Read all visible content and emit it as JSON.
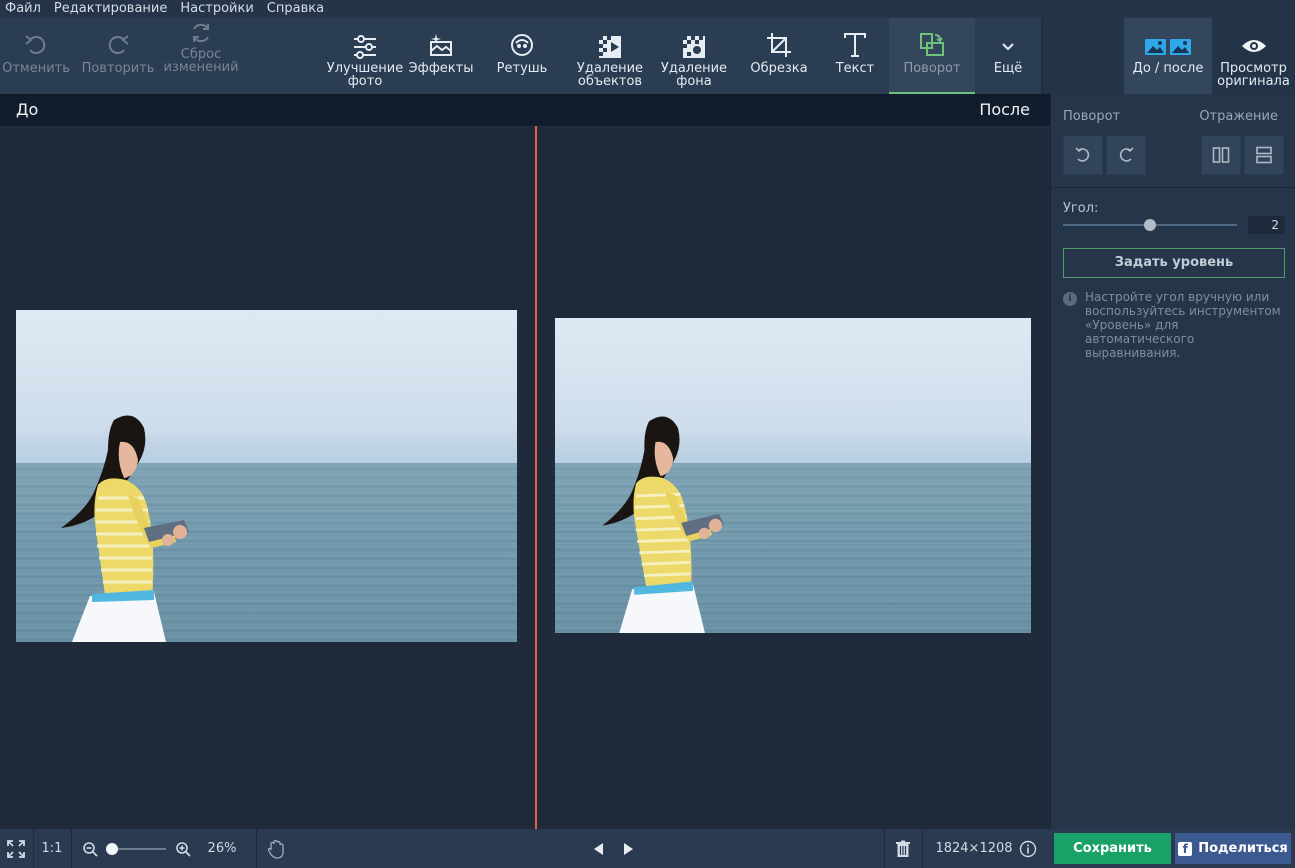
{
  "menu": [
    "Файл",
    "Редактирование",
    "Настройки",
    "Справка"
  ],
  "toolbar": {
    "undo": "Отменить",
    "redo": "Повторить",
    "reset": "Сброс\nизменений",
    "enhance": "Улучшение\nфото",
    "effects": "Эффекты",
    "retouch": "Ретушь",
    "remove_objects": "Удаление\nобъектов",
    "remove_bg": "Удаление\nфона",
    "crop": "Обрезка",
    "text": "Текст",
    "rotate": "Поворот",
    "more": "Ещё",
    "before_after": "До / после",
    "view_original": "Просмотр\nоригинала"
  },
  "compare": {
    "before": "До",
    "after": "После"
  },
  "panel": {
    "rotate_label": "Поворот",
    "flip_label": "Отражение",
    "angle_label": "Угол:",
    "angle_value": "2",
    "angle_fraction": 0.5,
    "level_button": "Задать уровень",
    "hint": "Настройте угол вручную или воспользуйтесь инструментом «Уровень» для автоматического выравнивания."
  },
  "status": {
    "actual_size": "1:1",
    "zoom": "26%",
    "dimensions": "1824×1208",
    "save": "Сохранить",
    "share": "Поделиться"
  },
  "colors": {
    "accent_green": "#1aa168",
    "divider_red": "#e2604a",
    "share_blue": "#3c5a8f"
  }
}
